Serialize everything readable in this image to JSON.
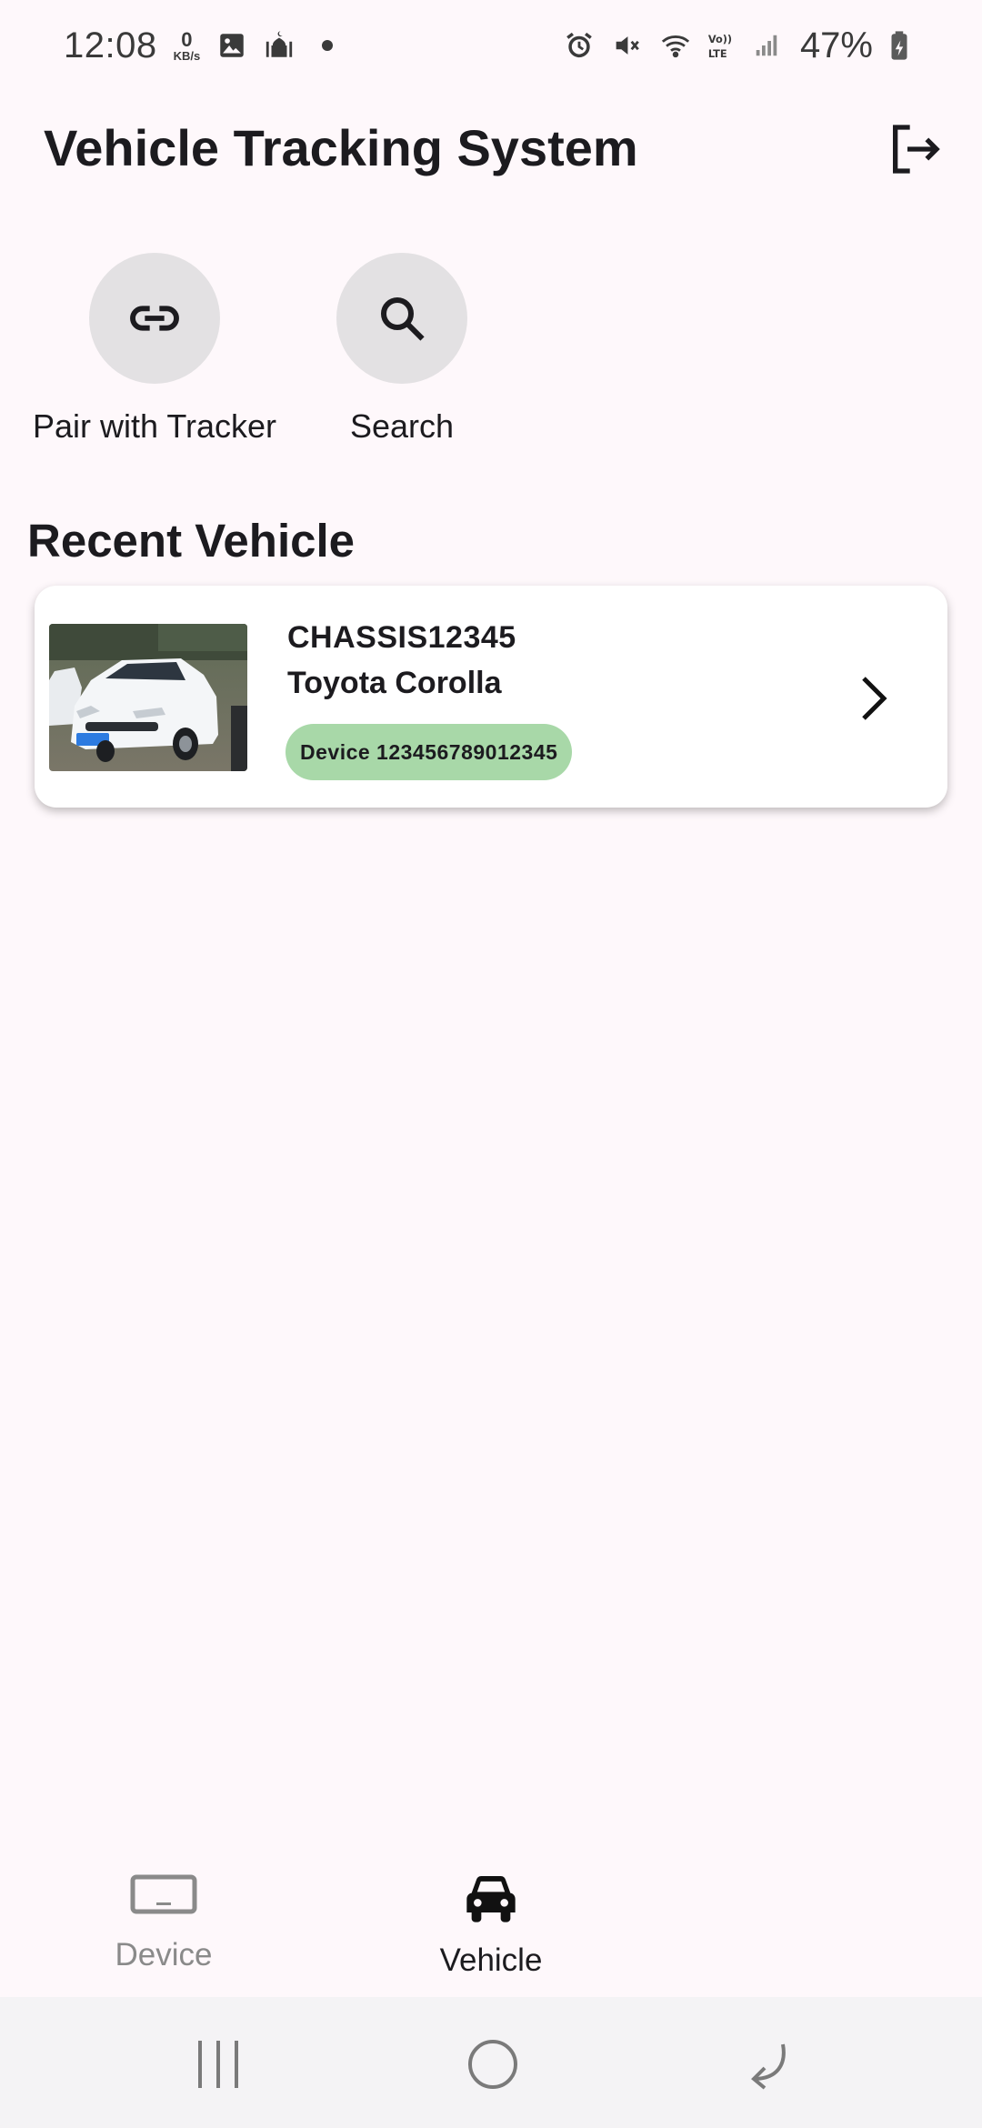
{
  "status_bar": {
    "time": "12:08",
    "kbs_value": "0",
    "kbs_unit": "KB/s",
    "battery": "47%",
    "icons": [
      "gallery-icon",
      "mosque-icon",
      "alarm-icon",
      "mute-icon",
      "wifi-icon",
      "volte-icon",
      "signal-icon",
      "battery-icon"
    ]
  },
  "header": {
    "title": "Vehicle Tracking System",
    "logout_icon": "logout-icon"
  },
  "actions": [
    {
      "label": "Pair with Tracker",
      "icon": "link-icon"
    },
    {
      "label": "Search",
      "icon": "search-icon"
    }
  ],
  "section": {
    "title": "Recent Vehicle"
  },
  "recent_vehicle": {
    "chassis": "CHASSIS12345",
    "model": "Toyota Corolla",
    "device": "Device 123456789012345",
    "chip_color": "#a8d8a8"
  },
  "bottom_nav": {
    "items": [
      {
        "label": "Device",
        "icon": "device-icon",
        "selected": false
      },
      {
        "label": "Vehicle",
        "icon": "car-icon",
        "selected": true
      }
    ]
  },
  "system_nav": [
    "recents-icon",
    "home-icon",
    "back-icon"
  ]
}
